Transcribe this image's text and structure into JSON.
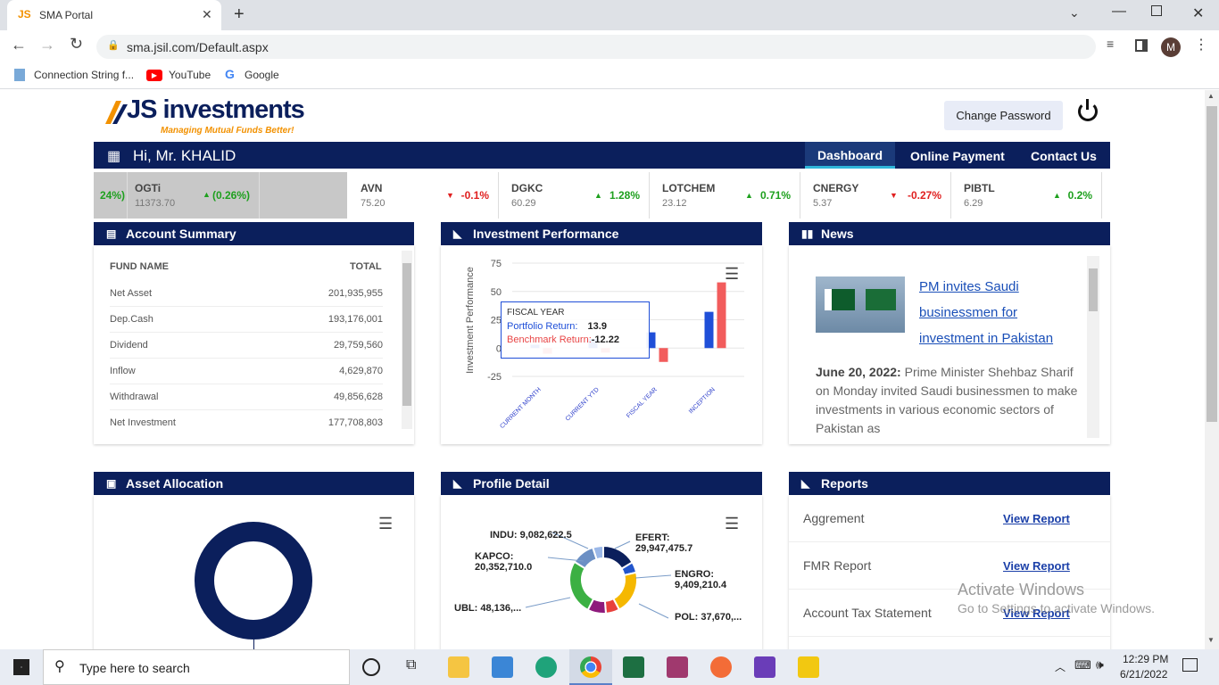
{
  "browser": {
    "tab_title": "SMA Portal",
    "url": "sma.jsil.com/Default.aspx",
    "profile": "M",
    "bookmarks": [
      "Connection String f...",
      "YouTube",
      "Google"
    ]
  },
  "header": {
    "logo_text": "JS investments",
    "tagline": "Managing Mutual Funds Better!",
    "change_password": "Change Password"
  },
  "nav": {
    "greeting": "Hi, Mr. KHALID",
    "items": [
      "Dashboard",
      "Online Payment",
      "Contact Us"
    ]
  },
  "ticker": [
    {
      "sym": "",
      "price": "",
      "change": "24%)",
      "dir": "up"
    },
    {
      "sym": "OGTi",
      "price": "11373.70",
      "change": "(0.26%)",
      "dir": "up"
    },
    {
      "sym": "AVN",
      "price": "75.20",
      "change": "-0.1%",
      "dir": "dn"
    },
    {
      "sym": "DGKC",
      "price": "60.29",
      "change": "1.28%",
      "dir": "up"
    },
    {
      "sym": "LOTCHEM",
      "price": "23.12",
      "change": "0.71%",
      "dir": "up"
    },
    {
      "sym": "CNERGY",
      "price": "5.37",
      "change": "-0.27%",
      "dir": "dn"
    },
    {
      "sym": "PIBTL",
      "price": "6.29",
      "change": "0.2%",
      "dir": "up"
    }
  ],
  "account_summary": {
    "title": "Account Summary",
    "col_name": "FUND NAME",
    "col_total": "TOTAL",
    "rows": [
      [
        "Net Asset",
        "201,935,955"
      ],
      [
        "Dep.Cash",
        "193,176,001"
      ],
      [
        "Dividend",
        "29,759,560"
      ],
      [
        "Inflow",
        "4,629,870"
      ],
      [
        "Withdrawal",
        "49,856,628"
      ],
      [
        "Net Investment",
        "177,708,803"
      ]
    ]
  },
  "investment_performance": {
    "title": "Investment Performance",
    "tooltip": {
      "header": "FISCAL YEAR",
      "portfolio_label": "Portfolio Return:",
      "portfolio_value": "13.9",
      "benchmark_label": "Benchmark Return:",
      "benchmark_value": "-12.22"
    }
  },
  "chart_data": {
    "type": "bar",
    "ylabel": "Investment Performance",
    "ylim": [
      -25,
      75
    ],
    "yticks": [
      75,
      50,
      25,
      0,
      -25
    ],
    "categories": [
      "CURRENT MONTH",
      "CURRENT YTD",
      "FISCAL YEAR",
      "INCEPTION"
    ],
    "series": [
      {
        "name": "Portfolio Return",
        "color": "#1f4fd8",
        "values": [
          3,
          8,
          13.9,
          32
        ]
      },
      {
        "name": "Benchmark Return",
        "color": "#f25c5c",
        "values": [
          -5,
          -4,
          -12.22,
          58
        ]
      }
    ]
  },
  "news": {
    "title": "News",
    "headline": "PM invites Saudi businessmen for investment in Pakistan",
    "date": "June 20, 2022:",
    "body": "Prime Minister Shehbaz Sharif on Monday invited Saudi businessmen to make investments in various economic sectors of Pakistan as"
  },
  "asset_allocation": {
    "title": "Asset Allocation",
    "color": "#0b1f5c"
  },
  "profile_detail": {
    "title": "Profile Detail",
    "slices": [
      {
        "label": "EFERT:\n29,947,475.7",
        "value": 29947475.7,
        "color": "#0b1f5c"
      },
      {
        "label": "ENGRO:\n9,409,210.4",
        "value": 9409210.4,
        "color": "#2255cc"
      },
      {
        "label": "POL: 37,670,...",
        "value": 37670000,
        "color": "#f5b800"
      },
      {
        "label": "",
        "value": 12000000,
        "color": "#e8413c"
      },
      {
        "label": "",
        "value": 16000000,
        "color": "#8e1a7c"
      },
      {
        "label": "UBL: 48,136,...",
        "value": 48136000,
        "color": "#3cb043"
      },
      {
        "label": "KAPCO:\n20,352,710.0",
        "value": 20352710,
        "color": "#6b8fc4"
      },
      {
        "label": "INDU: 9,082,622.5",
        "value": 9082622.5,
        "color": "#9bb8e8"
      }
    ],
    "callouts": [
      "INDU: 9,082,622.5",
      "KAPCO:",
      "20,352,710.0",
      "EFERT:",
      "29,947,475.7",
      "ENGRO:",
      "9,409,210.4",
      "UBL: 48,136,...",
      "POL: 37,670,..."
    ]
  },
  "reports": {
    "title": "Reports",
    "items": [
      [
        "Aggrement",
        "View Report"
      ],
      [
        "FMR Report",
        "View Report"
      ],
      [
        "Account Tax Statement",
        "View Report"
      ]
    ]
  },
  "watermark": {
    "line1": "Activate Windows",
    "line2": "Go to Settings to activate Windows."
  },
  "taskbar": {
    "search_placeholder": "Type here to search",
    "time": "12:29 PM",
    "date": "6/21/2022"
  }
}
